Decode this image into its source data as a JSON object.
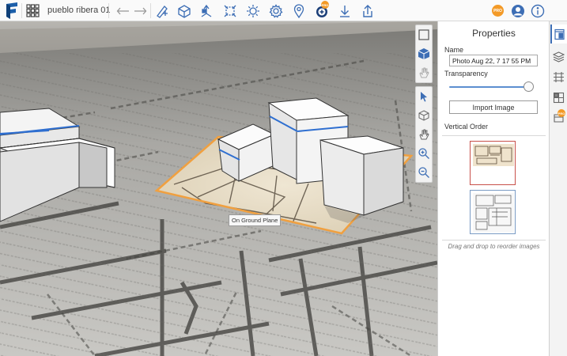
{
  "toolbar": {
    "project_name": "pueblo ribera 01",
    "pro_badge": "PRO",
    "icons": [
      "undo-icon",
      "redo-icon",
      "draw-pen-icon",
      "add-box-icon",
      "push-pull-icon",
      "transform-icon",
      "sun-icon",
      "settings-icon",
      "location-pin-icon",
      "formit-pro-icon",
      "download-icon",
      "share-icon",
      "pro-icon",
      "account-icon",
      "info-icon"
    ]
  },
  "viewport": {
    "tooltip": "On Ground Plane",
    "upper_tools": [
      "window-select-icon",
      "3d-cube-view-icon",
      "hand-gesture-icon"
    ],
    "lower_tools": [
      "select-arrow-icon",
      "orbit-icon",
      "pan-hand-icon",
      "zoom-icon",
      "zoom-extents-icon"
    ]
  },
  "properties": {
    "title": "Properties",
    "name_label": "Name",
    "name_value": "Photo Aug 22, 7 17 55 PM",
    "transparency_label": "Transparency",
    "transparency_value": 0.95,
    "import_button": "Import Image",
    "vertical_order_label": "Vertical Order",
    "images": [
      {
        "id": "thumb-1",
        "selected": true
      },
      {
        "id": "thumb-2",
        "selected": false
      }
    ],
    "drag_hint": "Drag and drop to reorder images"
  },
  "right_strip": {
    "items": [
      "properties-panel-icon",
      "layers-icon",
      "levels-icon",
      "materials-icon",
      "pro-features-icon"
    ]
  },
  "colors": {
    "accent": "#3d6eb5",
    "pro_orange": "#f39a27",
    "selection_orange": "#f0a040",
    "building_edge_blue": "#2f6fd0"
  }
}
